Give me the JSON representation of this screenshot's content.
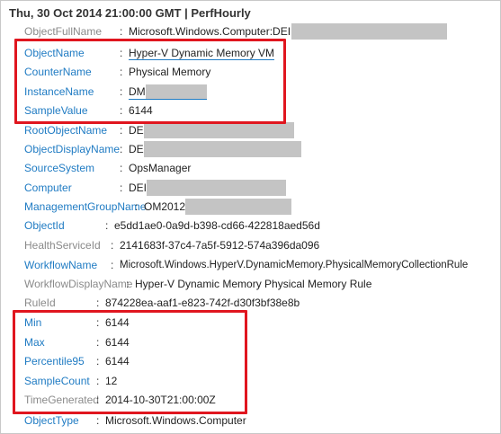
{
  "header": "Thu, 30 Oct 2014 21:00:00 GMT | PerfHourly",
  "colon": ":",
  "fields": [
    {
      "key": "ObjectFullName",
      "value": "Microsoft.Windows.Computer:DEI"
    },
    {
      "key": "ObjectName",
      "value": "Hyper-V Dynamic Memory VM"
    },
    {
      "key": "CounterName",
      "value": "Physical Memory"
    },
    {
      "key": "InstanceName",
      "value": "DM"
    },
    {
      "key": "SampleValue",
      "value": "6144"
    },
    {
      "key": "RootObjectName",
      "value": "DE"
    },
    {
      "key": "ObjectDisplayName",
      "value": "DE"
    },
    {
      "key": "SourceSystem",
      "value": "OpsManager"
    },
    {
      "key": "Computer",
      "value": "DEI"
    },
    {
      "key": "ManagementGroupName",
      "value": "OM2012"
    },
    {
      "key": "ObjectId",
      "value": "e5dd1ae0-0a9d-b398-cd66-422818aed56d"
    },
    {
      "key": "HealthServiceId",
      "value": "2141683f-37c4-7a5f-5912-574a396da096"
    },
    {
      "key": "WorkflowName",
      "value": "Microsoft.Windows.HyperV.DynamicMemory.PhysicalMemoryCollectionRule"
    },
    {
      "key": "WorkflowDisplayName",
      "value": "Hyper-V Dynamic Memory Physical Memory Rule"
    },
    {
      "key": "RuleId",
      "value": "874228ea-aaf1-e823-742f-d30f3bf38e8b"
    },
    {
      "key": "Min",
      "value": "6144"
    },
    {
      "key": "Max",
      "value": "6144"
    },
    {
      "key": "Percentile95",
      "value": "6144"
    },
    {
      "key": "SampleCount",
      "value": "12"
    },
    {
      "key": "TimeGenerated",
      "value": "2014-10-30T21:00:00Z"
    },
    {
      "key": "ObjectType",
      "value": "Microsoft.Windows.Computer"
    }
  ],
  "colors": {
    "link": "#1f7bc3",
    "grey": "#8a8a8a",
    "highlight": "#e0161f"
  }
}
